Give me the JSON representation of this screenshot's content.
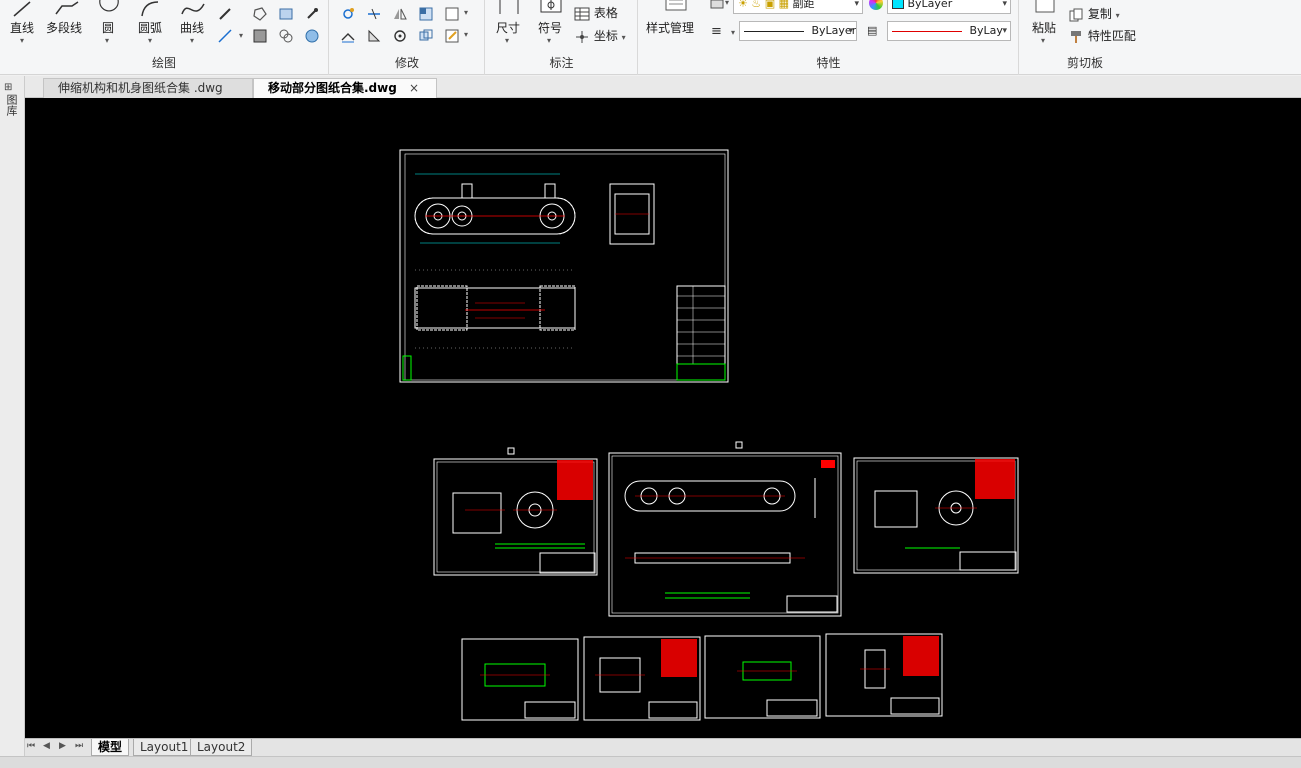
{
  "ribbon": {
    "draw": {
      "label": "绘图",
      "tools": {
        "line": "直线",
        "polyline": "多段线",
        "circle": "圆",
        "arc": "圆弧",
        "curve": "曲线"
      }
    },
    "modify": {
      "label": "修改"
    },
    "annotate": {
      "label": "标注",
      "tools": {
        "dimension": "尺寸",
        "symbol": "符号",
        "table": "表格",
        "coordinate": "坐标"
      }
    },
    "properties": {
      "label": "特性",
      "style_manager": "样式管理",
      "layer_value": "副距",
      "color_value": "ByLayer",
      "linetype_value": "ByLayer",
      "lineweight_value": "ByLay"
    },
    "clipboard": {
      "label": "剪切板",
      "paste": "粘贴",
      "copy": "复制",
      "match_properties": "特性匹配"
    }
  },
  "doc_tabs": [
    {
      "label": "伸缩机构和机身图纸合集 .dwg"
    },
    {
      "label": "移动部分图纸合集.dwg",
      "close": "×"
    }
  ],
  "left_panel_label": "图库",
  "layout_tabs": [
    "模型",
    "Layout1",
    "Layout2"
  ],
  "nav_buttons": [
    "⏮",
    "◀",
    "▶",
    "⏭"
  ],
  "colors": {
    "canvas_bg": "#000000",
    "cad_white": "#ffffff",
    "cad_green": "#00ff00",
    "cad_red": "#ff0000",
    "cad_cyan": "#00ffff",
    "cad_yellow": "#ffff00",
    "color_swatch": "#00e5ff",
    "lineweight_red": "#e00000"
  },
  "icons": {
    "line": "line-icon",
    "polyline": "polyline-icon",
    "circle": "circle-icon",
    "arc": "arc-icon",
    "curve": "curve-icon"
  }
}
